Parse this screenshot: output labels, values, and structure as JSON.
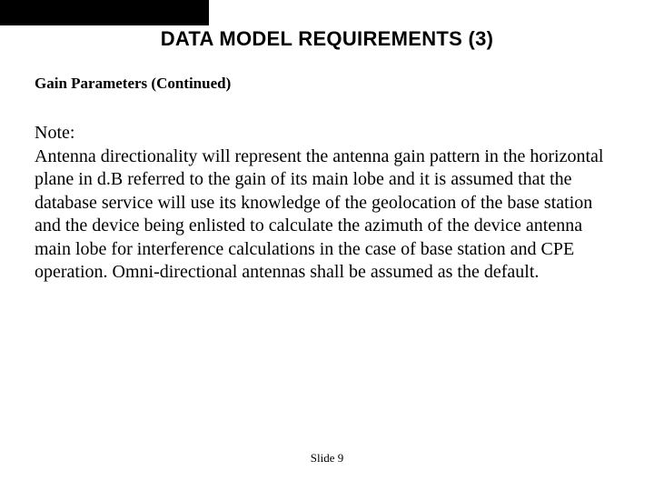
{
  "title": "DATA MODEL REQUIREMENTS (3)",
  "subtitle": "Gain Parameters (Continued)",
  "note_label": "Note:",
  "body": "Antenna directionality will represent the antenna gain pattern in the horizontal plane in d.B referred to the gain of its main lobe and it is assumed that the database service will use its knowledge of the geolocation of the base station and the device being enlisted to calculate the azimuth of the device antenna main lobe for interference calculations in the case of base station and CPE operation. Omni-directional antennas shall be assumed as the default.",
  "footer": "Slide 9"
}
